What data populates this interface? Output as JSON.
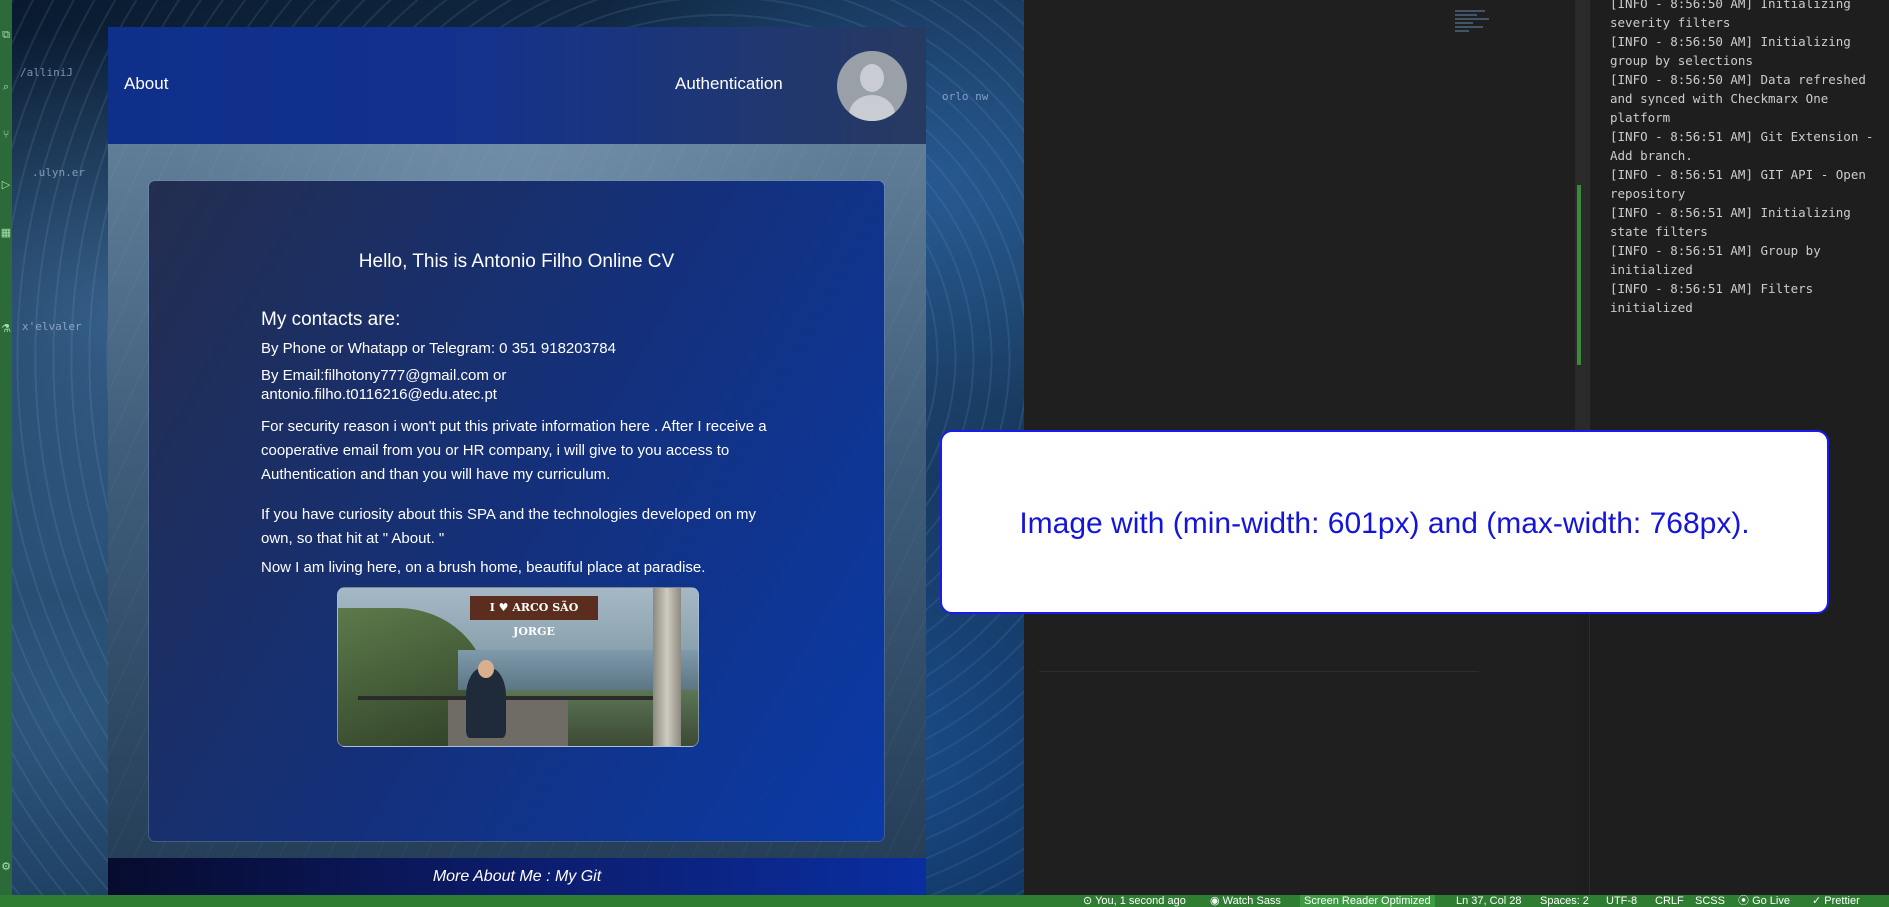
{
  "app": {
    "nav": {
      "about": "About",
      "authentication": "Authentication"
    },
    "card": {
      "title": "Hello, This is Antonio Filho Online CV",
      "contacts_heading": "My contacts are:",
      "phone": "By Phone or Whatapp or Telegram: 0 351 918203784",
      "email_line1": "By Email:filhotony777@gmail.com or",
      "email_line2": "antonio.filho.t0116216@edu.atec.pt",
      "security": "For security reason i won't put this private information here . After I receive a cooperative email from you or HR company, i will give to you access to Authentication and than you will have my curriculum.",
      "curiosity": "If you have curiosity about this SPA and the technologies developed on my own, so that hit at \" About. \"",
      "living": "Now I am living here, on a brush home, beautiful place at paradise.",
      "photo_sign": "I ♥ ARCO SÃO JORGE"
    },
    "footer": {
      "text": "More About Me : My Git"
    }
  },
  "overlay": {
    "text": "Image with (min-width: 601px) and (max-width: 768px)."
  },
  "output_log": [
    "[INFO - 8:56:50 AM] Initializing severity filters",
    "[INFO - 8:56:50 AM] Initializing group by selections",
    "[INFO - 8:56:50 AM] Data refreshed and synced with Checkmarx One platform",
    "[INFO - 8:56:51 AM] Git Extension - Add branch.",
    "[INFO - 8:56:51 AM] GIT API - Open repository",
    "[INFO - 8:56:51 AM] Initializing state filters",
    "[INFO - 8:56:51 AM] Group by initialized",
    "[INFO - 8:56:51 AM] Filters initialized"
  ],
  "statusbar": {
    "git_blame": "You, 1 second ago",
    "watch_sass": "Watch Sass",
    "screen_reader": "Screen Reader Optimized",
    "position": "Ln 37, Col 28",
    "spaces": "Spaces: 2",
    "encoding": "UTF-8",
    "eol": "CRLF",
    "language": "SCSS",
    "go_live": "Go Live",
    "prettier": "✓ Prettier"
  },
  "colors": {
    "accent_blue": "#1515d9",
    "statusbar_green": "#2e7d32",
    "nav_blue": "#0e2f8a"
  }
}
